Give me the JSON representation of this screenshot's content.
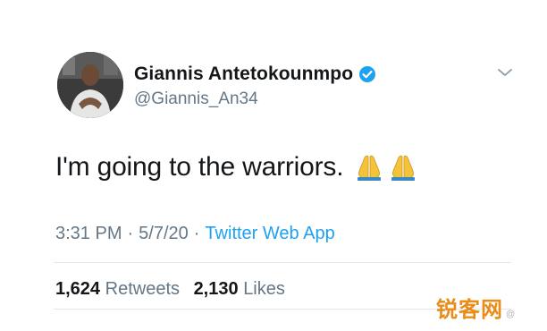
{
  "user": {
    "display_name": "Giannis Antetokounmpo",
    "handle": "@Giannis_An34",
    "verified": true
  },
  "tweet": {
    "text": "I'm going to the warriors.",
    "emojis": [
      "folded-hands-emoji",
      "folded-hands-emoji"
    ]
  },
  "meta": {
    "time": "3:31 PM",
    "date": "5/7/20",
    "separator": "·",
    "source": "Twitter Web App"
  },
  "stats": {
    "retweets_count": "1,624",
    "retweets_label": "Retweets",
    "likes_count": "2,130",
    "likes_label": "Likes"
  },
  "watermark": {
    "text": "锐客网",
    "sub": "@"
  },
  "colors": {
    "text": "#14171a",
    "secondary": "#657786",
    "accent": "#1da1f2",
    "divider": "#e1e8ed",
    "watermark": "#e8860c"
  }
}
